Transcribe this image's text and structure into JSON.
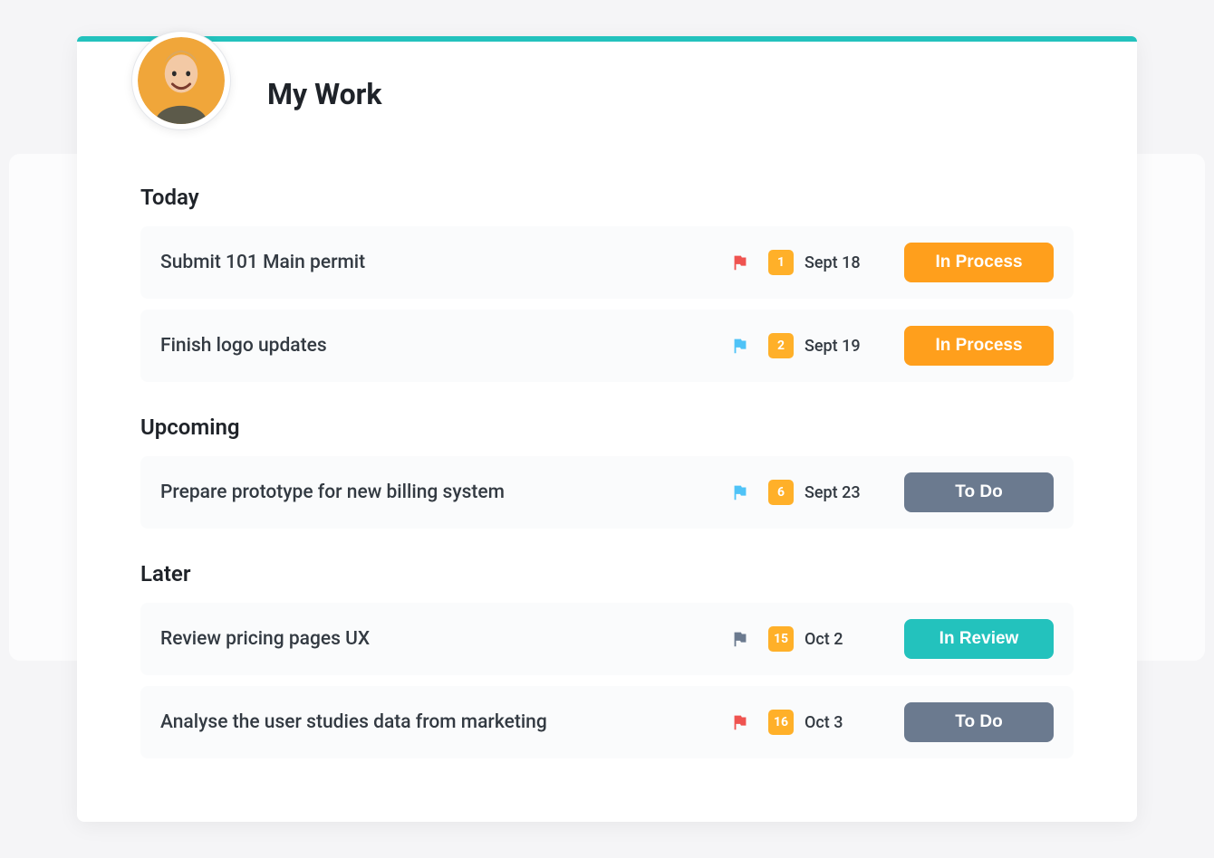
{
  "title": "My Work",
  "colors": {
    "accent": "#23c2bd",
    "dayChip": "#ffb029",
    "flagRed": "#ef5350",
    "flagBlue": "#4fc3f7",
    "flagGrey": "#6b7a8f"
  },
  "statusColors": {
    "In Process": "#ff9f1c",
    "To Do": "#6b7a8f",
    "In Review": "#23c2bd"
  },
  "sections": [
    {
      "title": "Today",
      "tasks": [
        {
          "title": "Submit 101 Main permit",
          "flagColor": "red",
          "day": "1",
          "dateLabel": "Sept 18",
          "status": "In Process"
        },
        {
          "title": "Finish logo updates",
          "flagColor": "blue",
          "day": "2",
          "dateLabel": "Sept 19",
          "status": "In Process"
        }
      ]
    },
    {
      "title": "Upcoming",
      "tasks": [
        {
          "title": "Prepare prototype for new billing system",
          "flagColor": "blue",
          "day": "6",
          "dateLabel": "Sept 23",
          "status": "To Do"
        }
      ]
    },
    {
      "title": "Later",
      "tasks": [
        {
          "title": "Review pricing pages UX",
          "flagColor": "grey",
          "day": "15",
          "dateLabel": "Oct 2",
          "status": "In Review"
        },
        {
          "title": "Analyse the user studies data from marketing",
          "flagColor": "red",
          "day": "16",
          "dateLabel": "Oct 3",
          "status": "To Do"
        }
      ]
    }
  ]
}
